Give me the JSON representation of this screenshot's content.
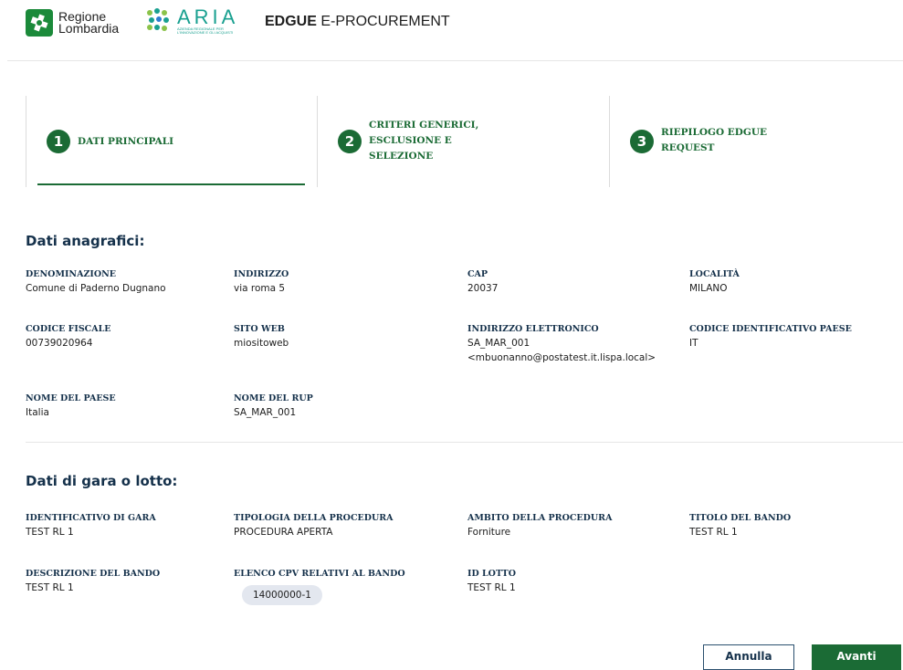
{
  "header": {
    "rl_logo_line1": "Regione",
    "rl_logo_line2": "Lombardia",
    "aria_logo_word": "ARIA",
    "aria_logo_tagline": "AZIENDA REGIONALE PER L'INNOVAZIONE E GLI ACQUISTI",
    "app_title_bold": "EDGUE",
    "app_title_rest": " E-PROCUREMENT"
  },
  "steps": [
    {
      "number": "1",
      "label_lines": [
        "DATI PRINCIPALI"
      ],
      "active": true
    },
    {
      "number": "2",
      "label_lines": [
        "CRITERI GENERICI,",
        "ESCLUSIONE E",
        "SELEZIONE"
      ],
      "active": false
    },
    {
      "number": "3",
      "label_lines": [
        "RIEPILOGO EDGUE",
        "REQUEST"
      ],
      "active": false
    }
  ],
  "anagrafici": {
    "title": "Dati anagrafici:",
    "denominazione": {
      "label": "DENOMINAZIONE",
      "value": "Comune di Paderno Dugnano"
    },
    "indirizzo": {
      "label": "INDIRIZZO",
      "value": "via roma 5"
    },
    "cap": {
      "label": "CAP",
      "value": "20037"
    },
    "localita": {
      "label": "LOCALITÀ",
      "value": "MILANO"
    },
    "codice_fiscale": {
      "label": "CODICE FISCALE",
      "value": "00739020964"
    },
    "sito_web": {
      "label": "SITO WEB",
      "value": "miositoweb"
    },
    "indirizzo_elettronico": {
      "label": "INDIRIZZO ELETTRONICO",
      "value_line1": "SA_MAR_001",
      "value_line2": "<mbuonanno@postatest.it.lispa.local>"
    },
    "codice_paese": {
      "label": "CODICE IDENTIFICATIVO PAESE",
      "value": "IT"
    },
    "nome_paese": {
      "label": "NOME DEL PAESE",
      "value": "Italia"
    },
    "nome_rup": {
      "label": "NOME DEL RUP",
      "value": "SA_MAR_001"
    }
  },
  "gara": {
    "title": "Dati di gara o lotto:",
    "identificativo": {
      "label": "IDENTIFICATIVO DI GARA",
      "value": "TEST RL 1"
    },
    "tipologia": {
      "label": "TIPOLOGIA DELLA PROCEDURA",
      "value": "PROCEDURA APERTA"
    },
    "ambito": {
      "label": "AMBITO DELLA PROCEDURA",
      "value": "Forniture"
    },
    "titolo": {
      "label": "TITOLO DEL BANDO",
      "value": "TEST RL 1"
    },
    "descrizione": {
      "label": "DESCRIZIONE DEL BANDO",
      "value": "TEST RL 1"
    },
    "cpv": {
      "label": "ELENCO CPV RELATIVI AL BANDO",
      "chip": "14000000-1"
    },
    "id_lotto": {
      "label": "ID LOTTO",
      "value": "TEST RL 1"
    }
  },
  "actions": {
    "cancel_label": "Annulla",
    "next_label": "Avanti"
  },
  "colors": {
    "primary_green": "#1b6b35",
    "heading_navy": "#15314b",
    "chip_bg": "#e3e7ef"
  }
}
